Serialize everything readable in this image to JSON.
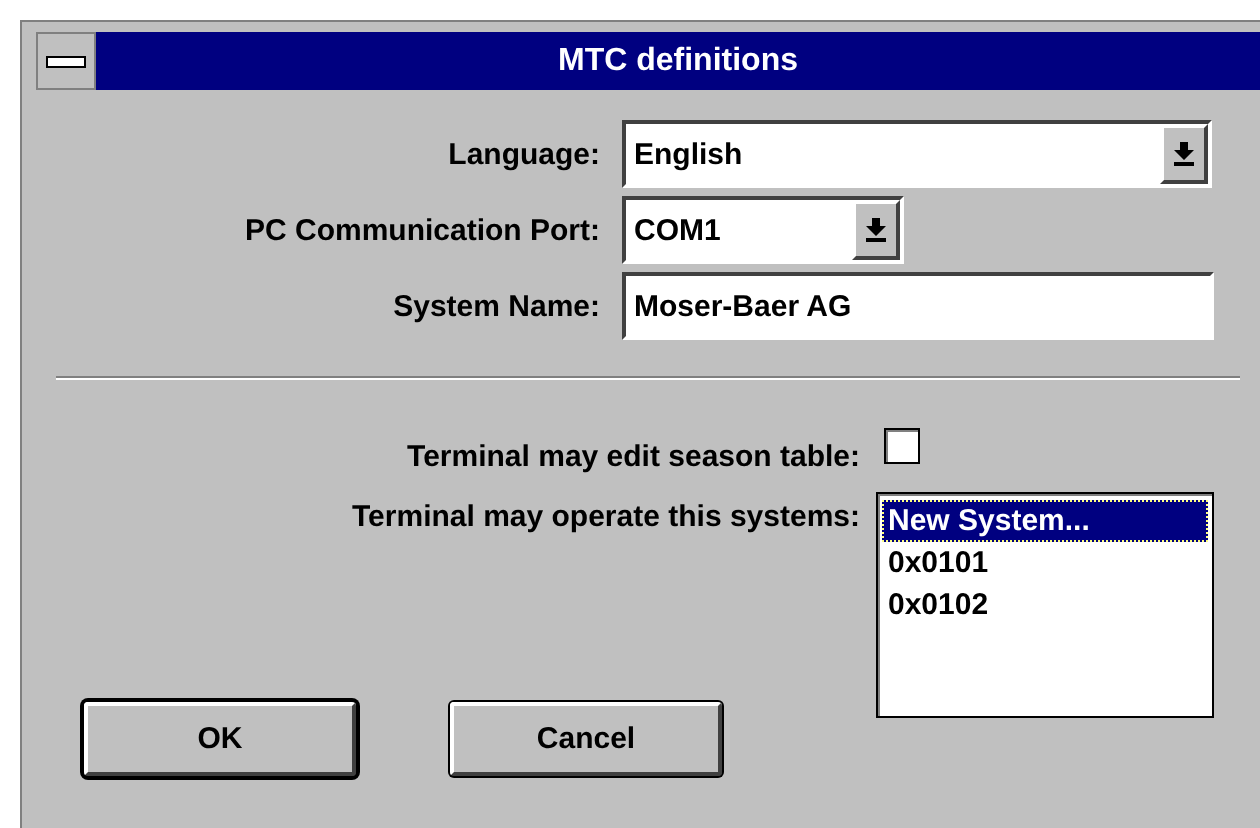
{
  "window": {
    "title": "MTC definitions"
  },
  "fields": [
    {
      "kind": "dropdown",
      "label": "Language:",
      "value": "English"
    },
    {
      "kind": "dropdown",
      "label": "PC Communication Port:",
      "value": "COM1"
    },
    {
      "kind": "text",
      "label": "System Name:",
      "value": "Moser-Baer AG"
    }
  ],
  "season_table": {
    "label": "Terminal may edit season table:",
    "checked": false
  },
  "systems": {
    "label": "Terminal may operate this systems:",
    "items": [
      {
        "text": "New System...",
        "selected": true
      },
      {
        "text": "0x0101",
        "selected": false
      },
      {
        "text": "0x0102",
        "selected": false
      }
    ]
  },
  "buttons": [
    {
      "label": "OK",
      "default": true
    },
    {
      "label": "Cancel",
      "default": false
    }
  ]
}
